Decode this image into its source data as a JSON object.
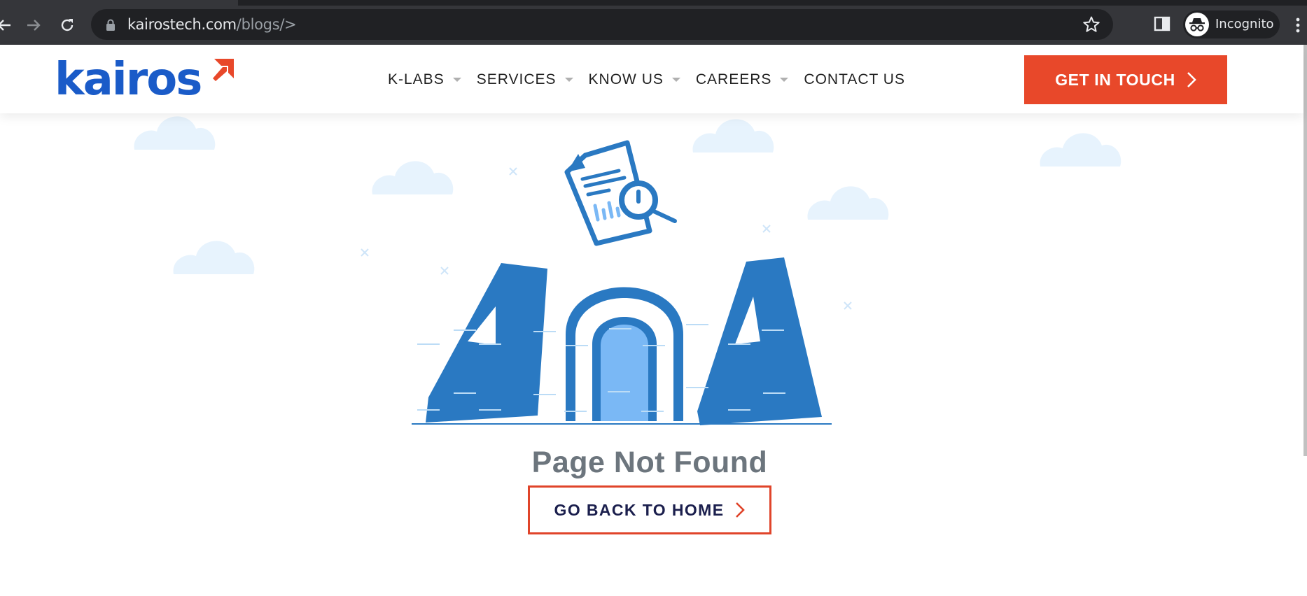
{
  "browser": {
    "url_host": "kairostech.com",
    "url_path": "/blogs/>",
    "profile_label": "Incognito"
  },
  "site": {
    "logo_text": "kairos",
    "nav": [
      {
        "label": "K-LABS",
        "has_dropdown": true
      },
      {
        "label": "SERVICES",
        "has_dropdown": true
      },
      {
        "label": "KNOW US",
        "has_dropdown": true
      },
      {
        "label": "CAREERS",
        "has_dropdown": true
      },
      {
        "label": "CONTACT US",
        "has_dropdown": false
      }
    ],
    "cta_label": "GET IN TOUCH"
  },
  "error": {
    "title": "Page Not Found",
    "home_button_label": "GO BACK TO HOME",
    "illustration": "404-illustration"
  },
  "colors": {
    "brand_blue": "#1a5bc8",
    "accent_orange": "#e8482a",
    "illustration_blue": "#2a79c2",
    "illustration_light": "#7ab8f5",
    "cloud": "#e7f3fd",
    "title_gray": "#6c757d",
    "navy": "#1b1f4d"
  },
  "icons": {
    "back": "arrow-left-icon",
    "forward": "arrow-right-icon",
    "reload": "reload-icon",
    "lock": "lock-icon",
    "bookmark": "star-icon",
    "side_panel": "side-panel-icon",
    "incognito": "incognito-icon",
    "menu": "kebab-menu-icon",
    "chevron": "chevron-right-icon"
  }
}
